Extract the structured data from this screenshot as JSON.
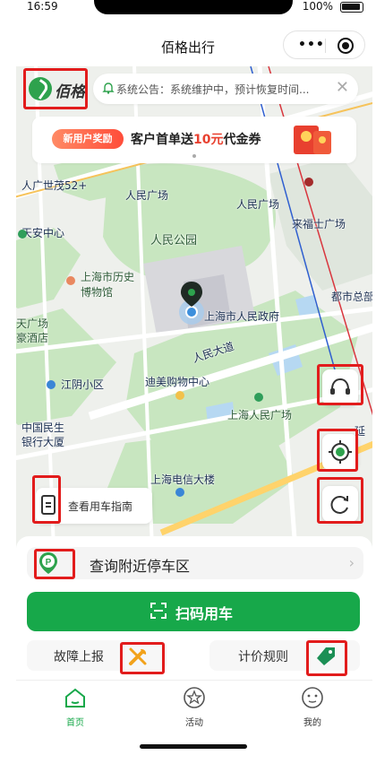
{
  "status_bar": {
    "time": "16:59",
    "battery": "100%"
  },
  "nav": {
    "title": "佰格出行",
    "menu_icon": "more-dots-icon",
    "close_icon": "target-circle-icon"
  },
  "logo": {
    "text": "佰格"
  },
  "notice": {
    "text": "系统公告：系统维护中，预计恢复时间...",
    "close": "✕"
  },
  "promo": {
    "tag": "新用户奖励",
    "text_before": "客户首单送",
    "highlight": "10元",
    "text_after": "代金券"
  },
  "map": {
    "labels": [
      "人广世茂52+",
      "人民广场",
      "人民广场",
      "来福士广场",
      "天安中心",
      "人民公园",
      "上海市历史博物馆",
      "上海市人民政府",
      "都市总部",
      "天广场",
      "豪酒店",
      "人民大道",
      "迪美购物中心",
      "上海人民广场",
      "江阴小区",
      "中国民生",
      "银行大厦",
      "上海电信大楼",
      "延"
    ],
    "colors": {
      "park": "#c8e6c0",
      "road": "#ffffff",
      "water": "#b6d8f2",
      "rail_red": "#d9363e",
      "rail_blue": "#2f5fd0"
    }
  },
  "controls": {
    "service_icon": "headset-icon",
    "locate_icon": "locate-icon",
    "refresh_icon": "refresh-icon",
    "guide_label": "查看用车指南"
  },
  "actions": {
    "parking_label": "查询附近停车区",
    "scan_label": "扫码用车",
    "fault_label": "故障上报",
    "price_label": "计价规则"
  },
  "tabs": [
    {
      "label": "首页",
      "icon": "home-icon",
      "active": true
    },
    {
      "label": "活动",
      "icon": "star-icon",
      "active": false
    },
    {
      "label": "我的",
      "icon": "profile-face-icon",
      "active": false
    }
  ]
}
